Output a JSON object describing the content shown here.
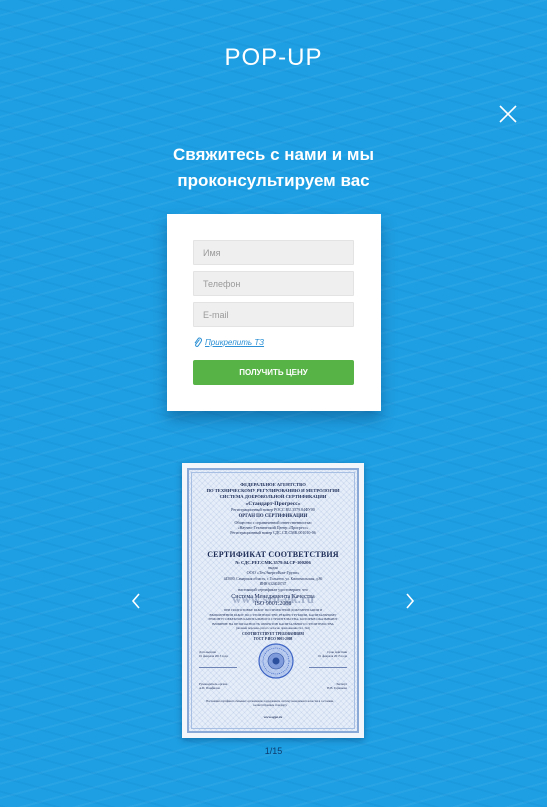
{
  "popup": {
    "label": "POP-UP"
  },
  "close": {
    "icon": "close-icon"
  },
  "form": {
    "heading_line1": "Свяжитесь с нами и мы",
    "heading_line2": "проконсультируем вас",
    "name_placeholder": "Имя",
    "phone_placeholder": "Телефон",
    "email_placeholder": "E-mail",
    "attach_icon": "paperclip-icon",
    "attach_label": "Прикрепить ТЗ",
    "submit_label": "ПОЛУЧИТЬ ЦЕНУ",
    "submit_color": "#58b347"
  },
  "gallery": {
    "prev_icon": "chevron-left-icon",
    "next_icon": "chevron-right-icon",
    "pager": "1/15"
  },
  "certificate": {
    "agency_line1": "ФЕДЕРАЛЬНОЕ АГЕНТСТВО",
    "agency_line2": "ПО ТЕХНИЧЕСКОМУ РЕГУЛИРОВАНИЮ И МЕТРОЛОГИИ",
    "agency_line3": "СИСТЕМА ДОБРОВОЛЬНОЙ СЕРТИФИКАЦИИ",
    "system_name": "«Стандарт-Прогресс»",
    "reg_number": "Регистрационный номер РОСС RU.3579.04ФУ00",
    "organ_title": "ОРГАН ПО СЕРТИФИКАЦИИ",
    "organ_line1": "Общество с ограниченной ответственностью",
    "organ_line2": "«Научно-Технический Центр «Прогресс»",
    "organ_line3": "Регистрационный номер СДС.СП.СМК.001010-06",
    "cert_title": "СЕРТИФИКАТ СООТВЕТСТВИЯ",
    "cert_number": "№ СДС.РЕГ.СМК.3579.04.СР-100206",
    "issued_label": "выдан",
    "company": "ООО «ТехЭнергоКом-Групп»",
    "address_line1": "445000, Самарская область, г. Тольятти, ул. Комсомольская, д.86",
    "address_line2": "ИНН 6324020747",
    "confirms": "настоящий сертификат удостоверяет, что",
    "qms_line": "Система Менеджмента Качества",
    "standard": "ISO 9001:2008",
    "scope_line1": "ПРИ ПОДГОТОВКЕ РАБОТ ПО ПРОЕКТНОЙ ДОКУМЕНТАЦИИ И",
    "scope_line2": "ВЫПОЛНЕНИИ РАБОТ ПО СТРОИТЕЛЬСТВУ, РЕКОНСТРУКЦИИ, КАПИТАЛЬНОМУ",
    "scope_line3": "РЕМОНТУ ОБЪЕКТОВ КАПИТАЛЬНОГО СТРОИТЕЛЬСТВА, КОТОРЫЕ ОКАЗЫВАЮТ",
    "scope_line4": "ВЛИЯНИЕ НА БЕЗОПАСНОСТЬ ОБЪЕКТОВ КАПИТАЛЬНОГО СТРОИТЕЛЬСТВА",
    "scope_line5": "(полный перечень работ согласно приложению №1, №2)",
    "requirements_title": "СООТВЕТСТВУЕТ ТРЕБОВАНИЯМ",
    "requirements_std": "ГОСТ Р ИСО 9001-2008",
    "watermark": "www.sro-gk.ru",
    "date_issued_label": "Дата выдачи",
    "date_issued": "01 февраля 2013 года",
    "valid_until_label": "Срок действия",
    "valid_until": "01 февраля 2015 года",
    "head_label": "Руководитель органа",
    "head_name": "А.И. Панфилов",
    "expert_label": "Эксперт",
    "expert_name": "Н.В. Горшкова",
    "footer_note": "Настоящий сертификат обязывает организацию поддерживать систему менеджмента качества в состоянии, соответствующем стандарту.",
    "site": "www.sgpc.ru"
  }
}
